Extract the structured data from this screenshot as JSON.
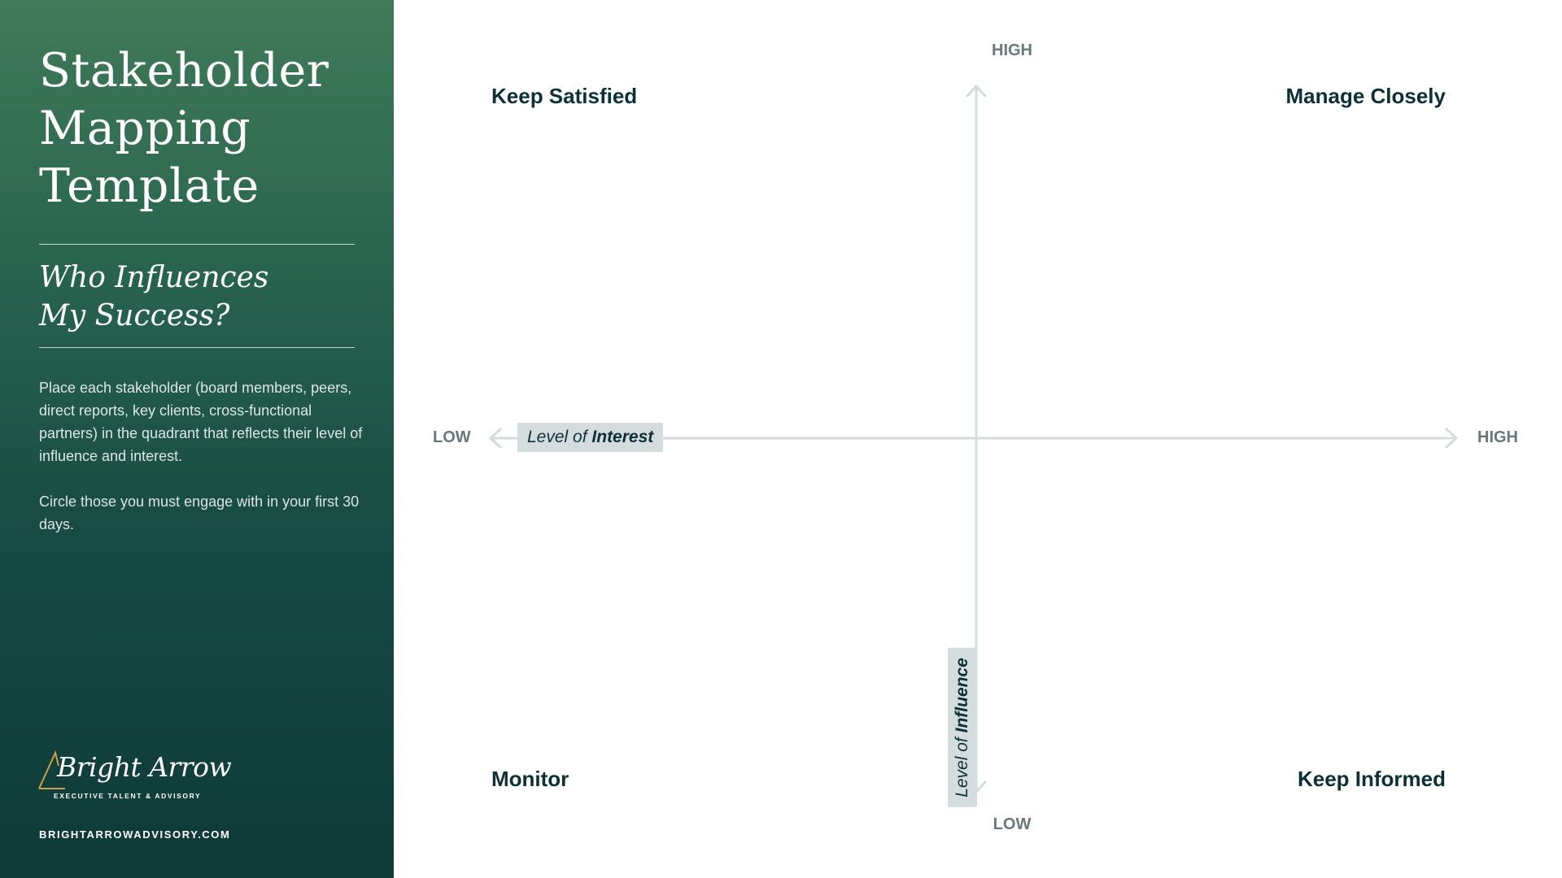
{
  "sidebar": {
    "title_lines": [
      "Stakeholder",
      "Mapping",
      "Template"
    ],
    "subtitle_lines": [
      "Who Influences",
      "My Success?"
    ],
    "description": "Place each stakeholder (board members, peers, direct reports, key clients, cross-functional partners) in the quadrant that reflects their level of influence and interest.",
    "instruction": "Circle those you must engage with in your first 30 days.",
    "logo": {
      "name": "Bright Arrow",
      "tagline": "EXECUTIVE TALENT & ADVISORY"
    },
    "website": "BRIGHTARROWADVISORY.COM"
  },
  "matrix": {
    "quadrants": {
      "top_left": "Keep Satisfied",
      "top_right": "Manage Closely",
      "bottom_left": "Monitor",
      "bottom_right": "Keep Informed"
    },
    "axis_ends": {
      "top": "HIGH",
      "bottom": "LOW",
      "left": "LOW",
      "right": "HIGH"
    },
    "x_axis": {
      "prefix": "Level of",
      "emphasis": "Interest"
    },
    "y_axis": {
      "prefix": "Level of",
      "emphasis": "Influence"
    }
  },
  "colors": {
    "sidebar_top": "#417a59",
    "sidebar_bottom": "#0e3a38",
    "quadrant_text": "#0c3036",
    "axis": "#d4dcde",
    "axis_end_text": "#69787d",
    "logo_accent": "#c9a24a"
  }
}
